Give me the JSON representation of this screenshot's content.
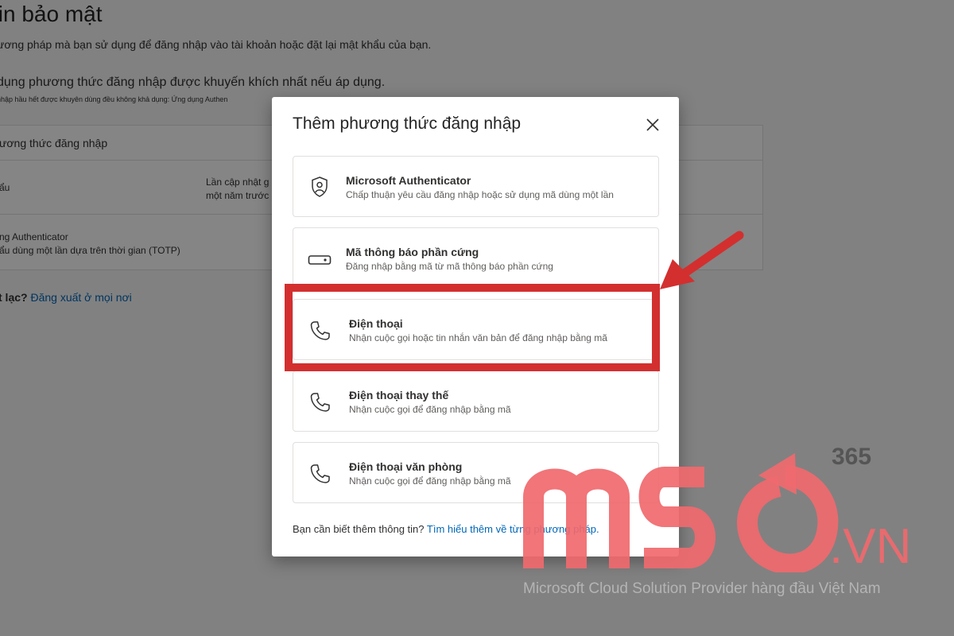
{
  "background_page": {
    "title": "tin bảo mật",
    "description": "ương pháp mà bạn sử dụng để đăng nhập vào tài khoản hoặc đặt lại mật khẩu của bạn.",
    "recommendation": "dụng phương thức đăng nhập được khuyến khích nhất nếu áp dụng.",
    "recommendation_small": "nhập hầu hết được khuyên dùng đều không khả dụng: Ứng dụng Authen",
    "table_header": "ương thức đăng nhập",
    "row1_col1": "ẩu",
    "row1_col2_line1": "Lần cập nhật g",
    "row1_col2_line2": "một năm trước",
    "row2_line1": "ng Authenticator",
    "row2_line2": "ẩu dùng một lần dựa trên thời gian (TOTP)",
    "lost_prefix": "t lạc?",
    "lost_link": "Đăng xuất ở mọi nơi"
  },
  "modal": {
    "title": "Thêm phương thức đăng nhập",
    "options": [
      {
        "title": "Microsoft Authenticator",
        "subtitle": "Chấp thuận yêu cầu đăng nhập hoặc sử dụng mã dùng một lần",
        "icon": "authenticator-lock-icon"
      },
      {
        "title": "Mã thông báo phần cứng",
        "subtitle": "Đăng nhập bằng mã từ mã thông báo phần cứng",
        "icon": "hardware-token-icon"
      },
      {
        "title": "Điện thoại",
        "subtitle": "Nhận cuộc gọi hoặc tin nhắn văn bản để đăng nhập bằng mã",
        "icon": "phone-icon"
      },
      {
        "title": "Điện thoại thay thế",
        "subtitle": "Nhận cuộc gọi để đăng nhập bằng mã",
        "icon": "phone-icon"
      },
      {
        "title": "Điện thoại văn phòng",
        "subtitle": "Nhận cuộc gọi để đăng nhập bằng mã",
        "icon": "phone-icon"
      }
    ],
    "footer_text": "Bạn cần biết thêm thông tin?",
    "footer_link": "Tìm hiểu thêm về từng phương pháp."
  },
  "watermark": {
    "brand": "MSO",
    "superscript": "365",
    "domain": ".VN",
    "tagline": "Microsoft Cloud Solution Provider hàng đầu Việt Nam",
    "color": "#f06a6e"
  },
  "colors": {
    "highlight": "#d32f2f",
    "link": "#0067b8"
  }
}
